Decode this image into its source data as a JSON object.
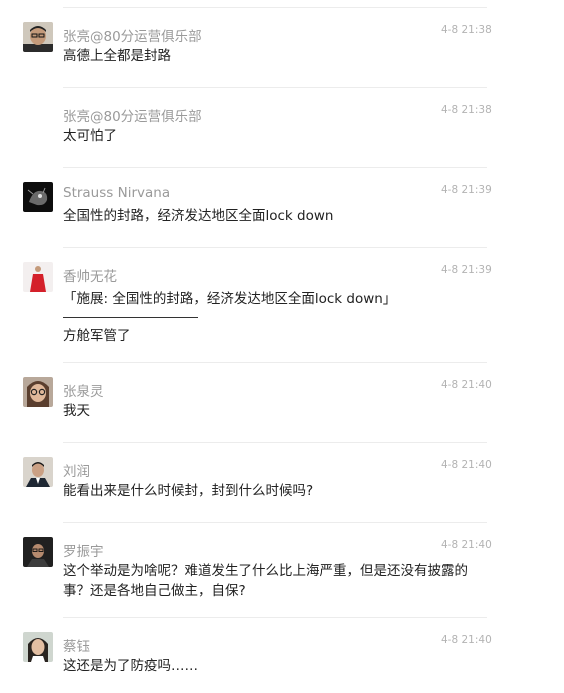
{
  "messages": [
    {
      "user": "张亮@80分运营俱乐部",
      "time": "4-8 21:38",
      "text": "高德上全都是封路",
      "avatar": "man-glasses"
    },
    {
      "user": "张亮@80分运营俱乐部",
      "time": "4-8 21:38",
      "text": "太可怕了",
      "avatar": ""
    },
    {
      "user": "Strauss Nirvana",
      "time": "4-8 21:39",
      "text": "全国性的封路，经济发达地区全面lock down",
      "avatar": "dark-animal"
    },
    {
      "user": "香帅无花",
      "time": "4-8 21:39",
      "quote": "「施展: 全国性的封路，经济发达地区全面lock down」",
      "text": "方舱军管了",
      "avatar": "red-dress"
    },
    {
      "user": "张泉灵",
      "time": "4-8 21:40",
      "text": "我天",
      "avatar": "woman-glasses"
    },
    {
      "user": "刘润",
      "time": "4-8 21:40",
      "text": "能看出来是什么时候封，封到什么时候吗?",
      "avatar": "man-suit"
    },
    {
      "user": "罗振宇",
      "time": "4-8 21:40",
      "text": "这个举动是为啥呢？难道发生了什么比上海严重，但是还没有披露的事？还是各地自己做主，自保?",
      "avatar": "man-dark"
    },
    {
      "user": "蔡钰",
      "time": "4-8 21:40",
      "text": "这还是为了防疫吗……",
      "avatar": "woman-hair"
    }
  ]
}
